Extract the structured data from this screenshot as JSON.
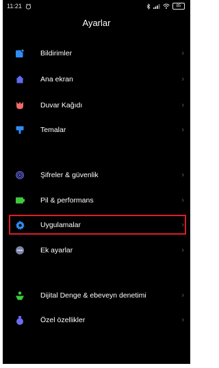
{
  "status_bar": {
    "time": "11:21",
    "battery": "85"
  },
  "header": {
    "title": "Ayarlar"
  },
  "menu": [
    {
      "label": "Bildirimler",
      "icon": "notification-icon",
      "color": "#2f8df5"
    },
    {
      "label": "Ana ekran",
      "icon": "home-icon",
      "color": "#5f6cf0"
    },
    {
      "label": "Duvar Kağıdı",
      "icon": "wallpaper-tulip-icon",
      "color": "#f06a6a"
    },
    {
      "label": "Temalar",
      "icon": "themes-brush-icon",
      "color": "#2f8df5"
    },
    {
      "label": "Şifreler & güvenlik",
      "icon": "fingerprint-icon",
      "color": "#6a6cf0"
    },
    {
      "label": "Pil & performans",
      "icon": "battery-icon",
      "color": "#3ec93e"
    },
    {
      "label": "Uygulamalar",
      "icon": "gear-icon",
      "color": "#2f8df5"
    },
    {
      "label": "Ek ayarlar",
      "icon": "more-dots-icon",
      "color": "#7c86a8"
    },
    {
      "label": "Dijital Denge & ebeveyn denetimi",
      "icon": "digital-wellbeing-icon",
      "color": "#3ec93e"
    },
    {
      "label": "Özel özellikler",
      "icon": "special-features-icon",
      "color": "#6a6cf0"
    }
  ],
  "highlight_color": "#e01b24"
}
